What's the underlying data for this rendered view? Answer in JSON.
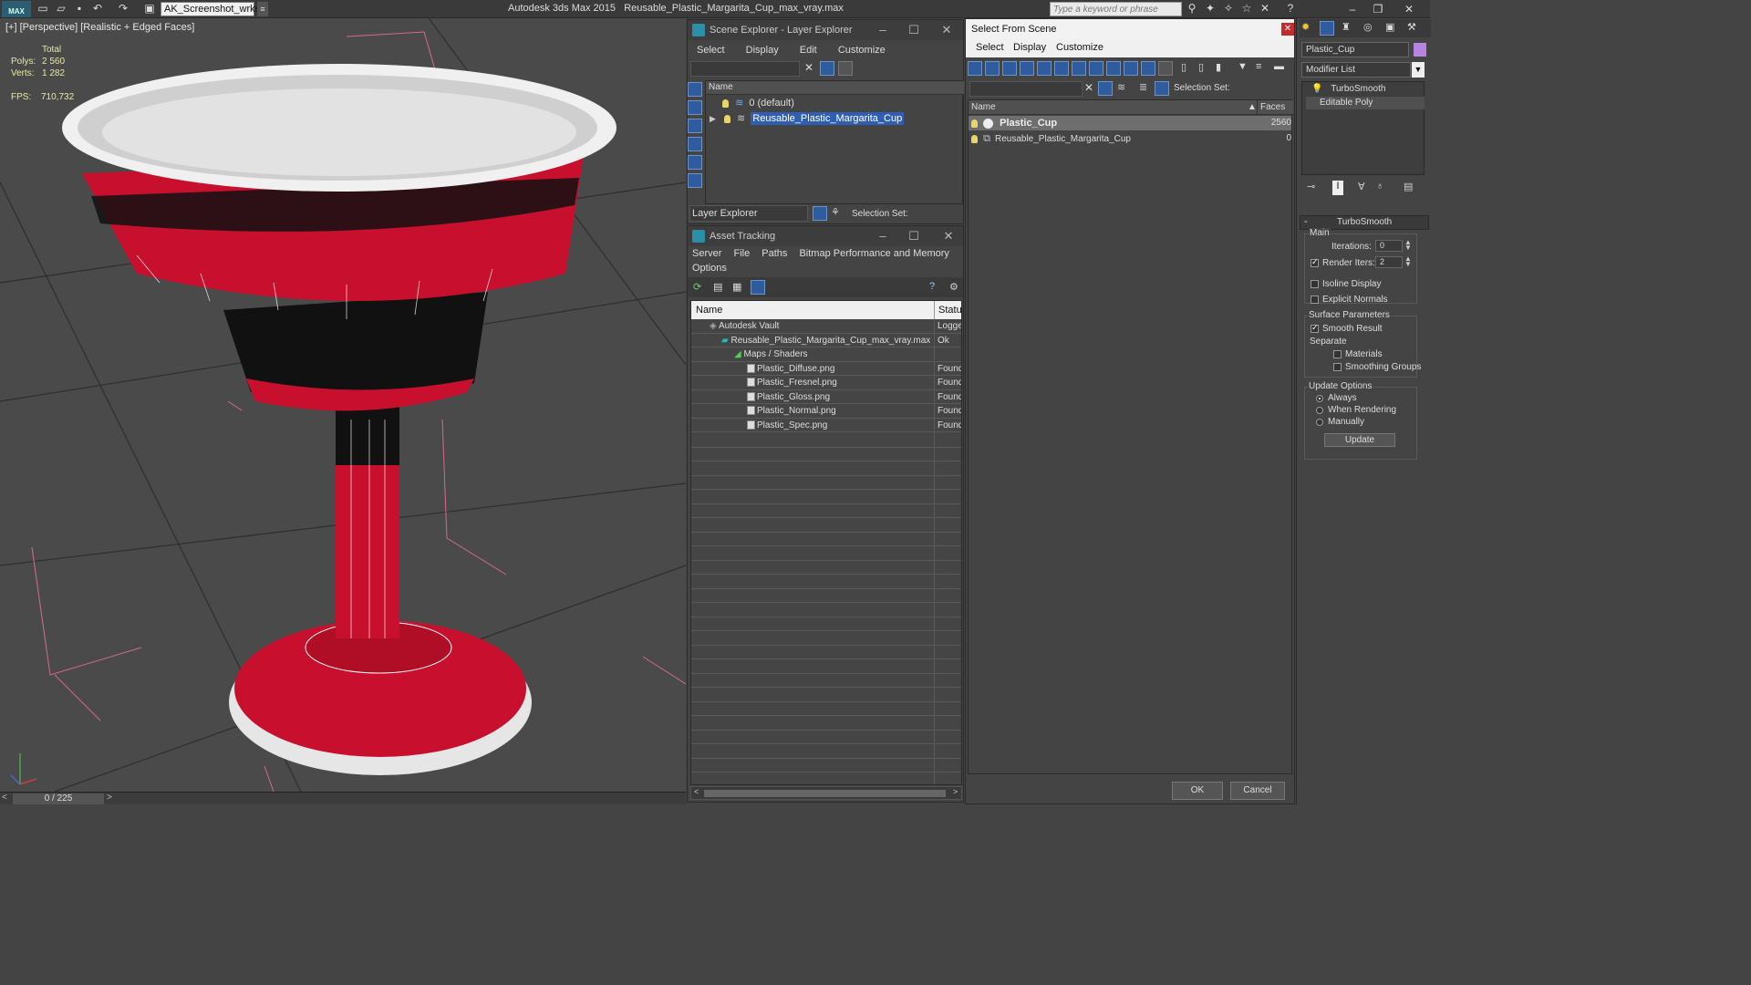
{
  "titlebar": {
    "logo": "MAX",
    "workspace": "AK_Screenshot_wrksp",
    "app_name": "Autodesk 3ds Max  2015",
    "file_name": "Reusable_Plastic_Margarita_Cup_max_vray.max",
    "search_placeholder": "Type a keyword or phrase",
    "icons": [
      "new-icon",
      "open-icon",
      "save-icon",
      "undo-icon",
      "redo-icon",
      "project-icon"
    ]
  },
  "viewport": {
    "label": "[+] [Perspective] [Realistic + Edged Faces]",
    "stats": {
      "total_label": "Total",
      "polys_label": "Polys:",
      "polys": "2 560",
      "verts_label": "Verts:",
      "verts": "1 282",
      "fps_label": "FPS:",
      "fps": "710,732"
    },
    "time_slider": "0 / 225",
    "colors": {
      "cup_red": "#c8102e",
      "cup_rim": "#e8e8e8",
      "grid": "#2c2c2c"
    }
  },
  "scene_explorer": {
    "title": "Scene Explorer - Layer Explorer",
    "menu": [
      "Select",
      "Display",
      "Edit",
      "Customize"
    ],
    "col_name": "Name",
    "rows": [
      {
        "label": "0 (default)",
        "selected": false
      },
      {
        "label": "Reusable_Plastic_Margarita_Cup",
        "selected": true
      }
    ],
    "footer_dropdown": "Layer Explorer",
    "selection_set_label": "Selection Set:"
  },
  "asset_tracking": {
    "title": "Asset Tracking",
    "menu": [
      "Server",
      "File",
      "Paths",
      "Bitmap Performance and Memory"
    ],
    "menu2": "Options",
    "col_name": "Name",
    "col_status": "Status",
    "rows": [
      {
        "name": "Autodesk Vault",
        "status": "Logged",
        "indent": 0
      },
      {
        "name": "Reusable_Plastic_Margarita_Cup_max_vray.max",
        "status": "Ok",
        "indent": 1
      },
      {
        "name": "Maps / Shaders",
        "status": "",
        "indent": 2
      },
      {
        "name": "Plastic_Diffuse.png",
        "status": "Found",
        "indent": 3
      },
      {
        "name": "Plastic_Fresnel.png",
        "status": "Found",
        "indent": 3
      },
      {
        "name": "Plastic_Gloss.png",
        "status": "Found",
        "indent": 3
      },
      {
        "name": "Plastic_Normal.png",
        "status": "Found",
        "indent": 3
      },
      {
        "name": "Plastic_Spec.png",
        "status": "Found",
        "indent": 3
      }
    ]
  },
  "select_from_scene": {
    "title": "Select From Scene",
    "menu": [
      "Select",
      "Display",
      "Customize"
    ],
    "selection_set_label": "Selection Set:",
    "col_name": "Name",
    "col_faces": "Faces",
    "rows": [
      {
        "name": "Plastic_Cup",
        "faces": "2560",
        "selected": true
      },
      {
        "name": "Reusable_Plastic_Margarita_Cup",
        "faces": "0",
        "selected": false
      }
    ],
    "ok": "OK",
    "cancel": "Cancel"
  },
  "command_panel": {
    "object_name": "Plastic_Cup",
    "object_color": "#b784e0",
    "modifier_list": "Modifier List",
    "stack": [
      "TurboSmooth",
      "Editable Poly"
    ],
    "rollout_title": "TurboSmooth",
    "main_label": "Main",
    "iterations_label": "Iterations:",
    "iterations": "0",
    "render_iters_label": "Render Iters:",
    "render_iters": "2",
    "isoline": "Isoline Display",
    "explicit_normals": "Explicit Normals",
    "surface_params": "Surface Parameters",
    "smooth_result": "Smooth Result",
    "separate": "Separate",
    "materials": "Materials",
    "smoothing_groups": "Smoothing Groups",
    "update_options": "Update Options",
    "always": "Always",
    "when_rendering": "When Rendering",
    "manually": "Manually",
    "update_button": "Update"
  }
}
